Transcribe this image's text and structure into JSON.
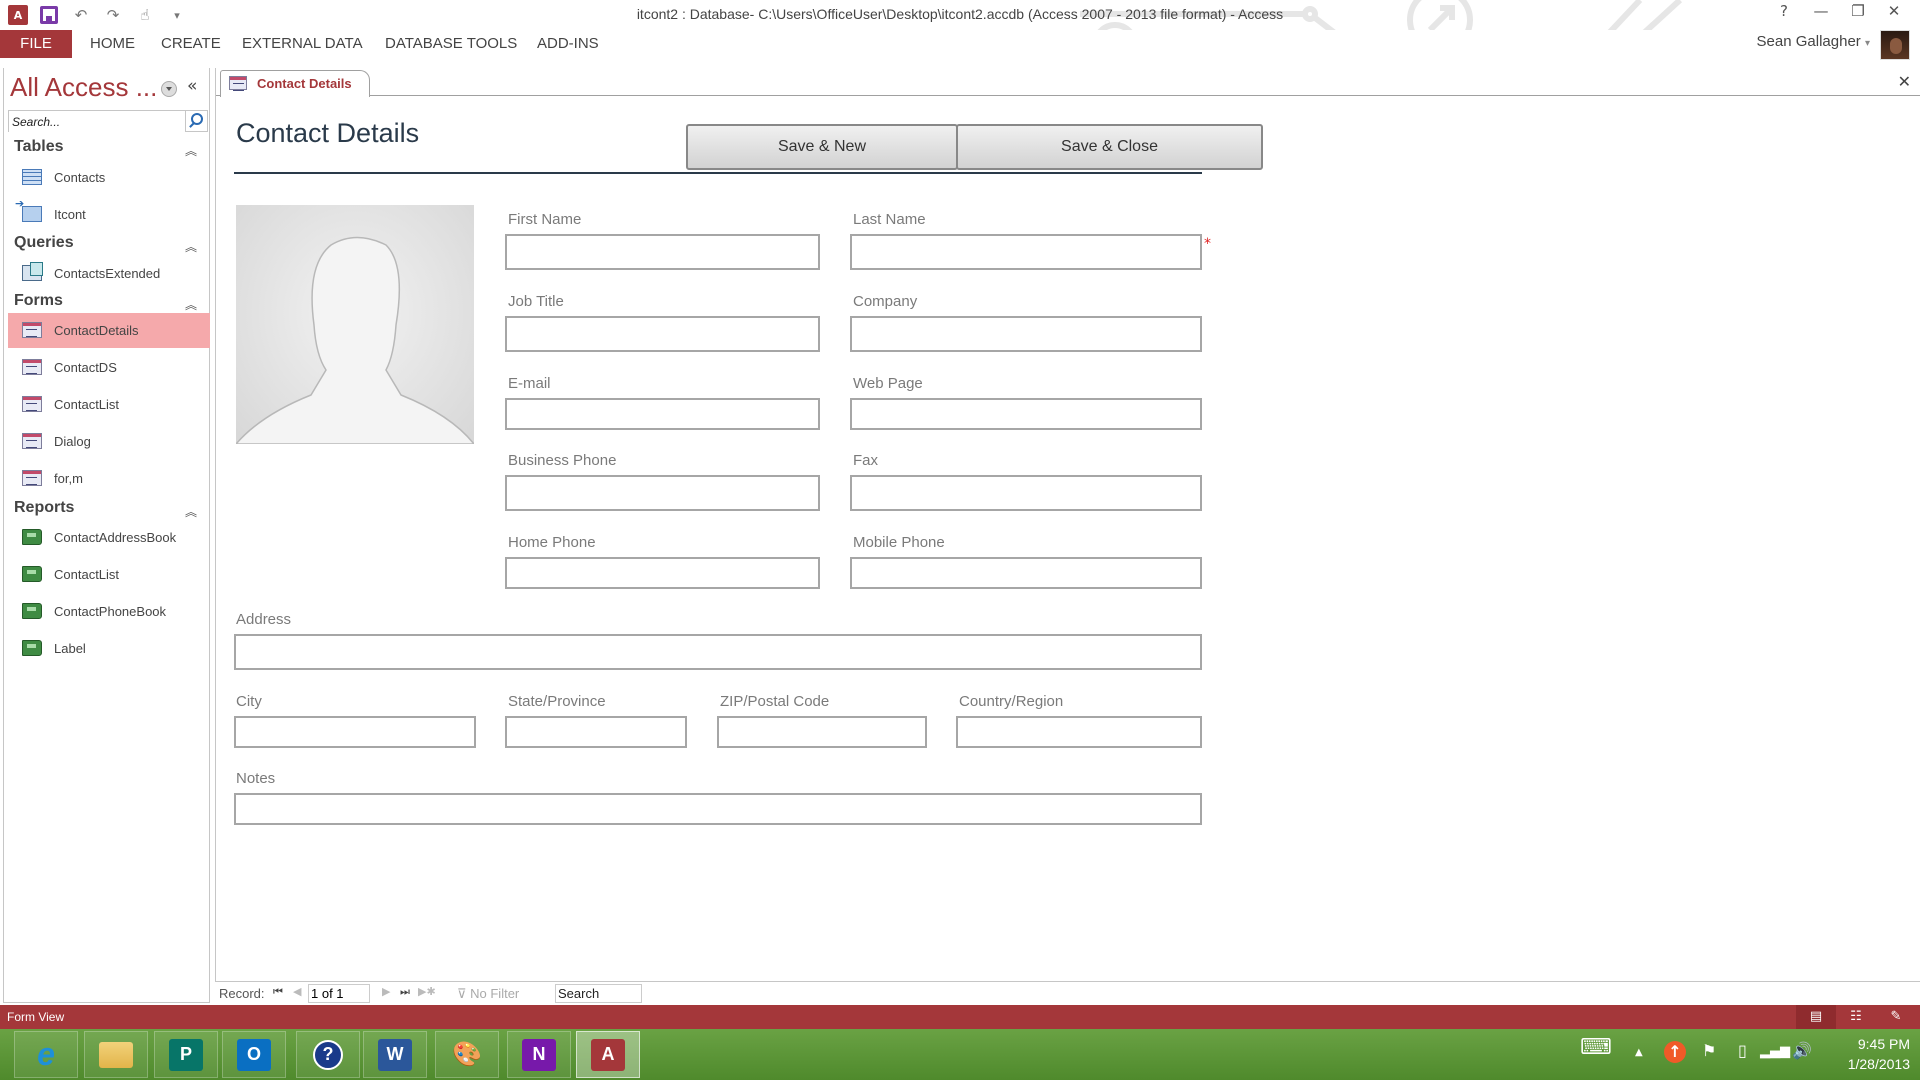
{
  "window": {
    "title": "itcont2 : Database- C:\\Users\\OfficeUser\\Desktop\\itcont2.accdb (Access 2007 - 2013 file format) - Access",
    "help": "?",
    "minimize": "—",
    "restore": "❐",
    "close": "✕"
  },
  "quick_access": {
    "app_icon": "A",
    "save_icon": "save-icon",
    "undo_icon": "↶",
    "redo_icon": "↷",
    "touch_icon": "☝",
    "customize_icon": "▾"
  },
  "ribbon": {
    "tabs": [
      {
        "label": "FILE"
      },
      {
        "label": "HOME"
      },
      {
        "label": "CREATE"
      },
      {
        "label": "EXTERNAL DATA"
      },
      {
        "label": "DATABASE TOOLS"
      },
      {
        "label": "ADD-INS"
      }
    ],
    "user_name": "Sean Gallagher",
    "user_dropdown": "▾"
  },
  "nav_pane": {
    "title": "All Access ...",
    "collapse": "«",
    "search_placeholder": "Search...",
    "groups": [
      {
        "label": "Tables",
        "chevron": "︽",
        "items": [
          {
            "label": "Contacts",
            "type": "table"
          },
          {
            "label": "Itcont",
            "type": "linked-table"
          }
        ]
      },
      {
        "label": "Queries",
        "chevron": "︽",
        "items": [
          {
            "label": "ContactsExtended",
            "type": "query"
          }
        ]
      },
      {
        "label": "Forms",
        "chevron": "︽",
        "items": [
          {
            "label": "ContactDetails",
            "type": "form",
            "selected": true
          },
          {
            "label": "ContactDS",
            "type": "form"
          },
          {
            "label": "ContactList",
            "type": "form"
          },
          {
            "label": "Dialog",
            "type": "form"
          },
          {
            "label": "for,m",
            "type": "form"
          }
        ]
      },
      {
        "label": "Reports",
        "chevron": "︽",
        "items": [
          {
            "label": "ContactAddressBook",
            "type": "report"
          },
          {
            "label": "ContactList",
            "type": "report"
          },
          {
            "label": "ContactPhoneBook",
            "type": "report"
          },
          {
            "label": "Label",
            "type": "report"
          }
        ]
      }
    ]
  },
  "document": {
    "tab_label": "Contact Details",
    "close": "✕"
  },
  "form": {
    "title": "Contact Details",
    "buttons": {
      "save_new": "Save & New",
      "save_close": "Save & Close"
    },
    "required_marker": "*",
    "fields": {
      "first_name": {
        "label": "First Name",
        "value": ""
      },
      "last_name": {
        "label": "Last Name",
        "value": ""
      },
      "job_title": {
        "label": "Job Title",
        "value": ""
      },
      "company": {
        "label": "Company",
        "value": ""
      },
      "email": {
        "label": "E-mail",
        "value": ""
      },
      "web_page": {
        "label": "Web Page",
        "value": ""
      },
      "business_phone": {
        "label": "Business Phone",
        "value": ""
      },
      "fax": {
        "label": "Fax",
        "value": ""
      },
      "home_phone": {
        "label": "Home Phone",
        "value": ""
      },
      "mobile_phone": {
        "label": "Mobile Phone",
        "value": ""
      },
      "address": {
        "label": "Address",
        "value": ""
      },
      "city": {
        "label": "City",
        "value": ""
      },
      "state": {
        "label": "State/Province",
        "value": ""
      },
      "zip": {
        "label": "ZIP/Postal Code",
        "value": ""
      },
      "country": {
        "label": "Country/Region",
        "value": ""
      },
      "notes": {
        "label": "Notes",
        "value": ""
      }
    }
  },
  "record_nav": {
    "label": "Record:",
    "first": "⏮",
    "prev": "◀",
    "position": "1 of 1",
    "next": "▶",
    "last": "⏭",
    "new": "▶✱",
    "filter": "No Filter",
    "search_placeholder": "Search"
  },
  "status_bar": {
    "text": "Form View",
    "views": [
      "form-view",
      "layout-view",
      "design-view"
    ]
  },
  "taskbar": {
    "apps": [
      {
        "name": "internet-explorer",
        "glyph": "e",
        "color": "#1e90d8"
      },
      {
        "name": "file-explorer",
        "glyph": "",
        "color": "#e8c25a"
      },
      {
        "name": "publisher",
        "glyph": "P",
        "color": "#077568"
      },
      {
        "name": "outlook",
        "glyph": "O",
        "color": "#0a6fc2"
      },
      {
        "name": "help",
        "glyph": "?",
        "color": "#1a3a8a"
      },
      {
        "name": "word",
        "glyph": "W",
        "color": "#2b579a"
      },
      {
        "name": "paint",
        "glyph": "🎨",
        "color": "#9ec4d8"
      },
      {
        "name": "onenote",
        "glyph": "N",
        "color": "#7719aa"
      },
      {
        "name": "access",
        "glyph": "A",
        "color": "#a4373a",
        "active": true
      }
    ],
    "tray": {
      "keyboard": "⌨",
      "show_hidden": "▲",
      "update": "↑",
      "flag": "⚑",
      "battery": "▯",
      "signal": "▂▄▆",
      "volume": "🔊"
    },
    "time": "9:45 PM",
    "date": "1/28/2013"
  }
}
